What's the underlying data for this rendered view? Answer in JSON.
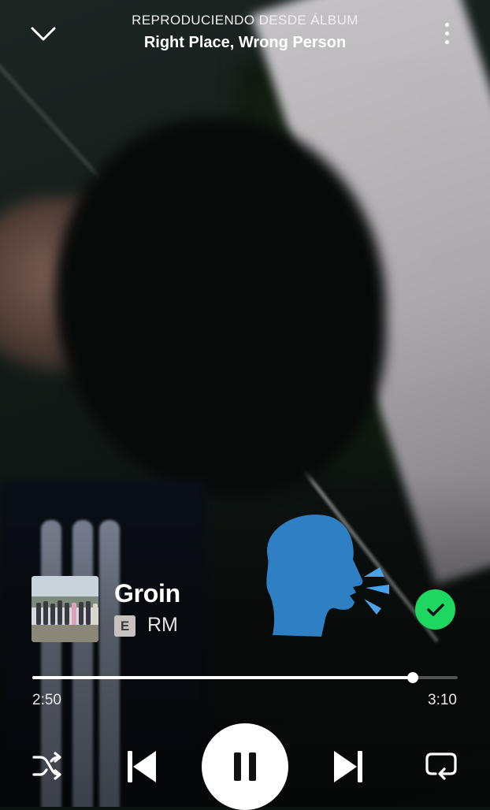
{
  "header": {
    "kicker": "REPRODUCIENDO DESDE ÁLBUM",
    "title": "Right Place, Wrong Person",
    "collapse_icon": "chevron-down-icon",
    "more_icon": "more-vertical-icon"
  },
  "sticker": {
    "icon": "speaking-head-icon"
  },
  "track": {
    "title": "Groin",
    "explicit_badge": "E",
    "artist": "RM",
    "saved": true,
    "saved_icon": "check-circle-icon"
  },
  "progress": {
    "elapsed": "2:50",
    "total": "3:10",
    "fraction": 0.895
  },
  "controls": {
    "shuffle_icon": "shuffle-icon",
    "previous_icon": "skip-previous-icon",
    "play_state": "playing",
    "pause_icon": "pause-icon",
    "next_icon": "skip-next-icon",
    "repeat_icon": "repeat-icon"
  },
  "colors": {
    "accent_green": "#1ed760",
    "sticker_blue": "#2f7fc4"
  }
}
